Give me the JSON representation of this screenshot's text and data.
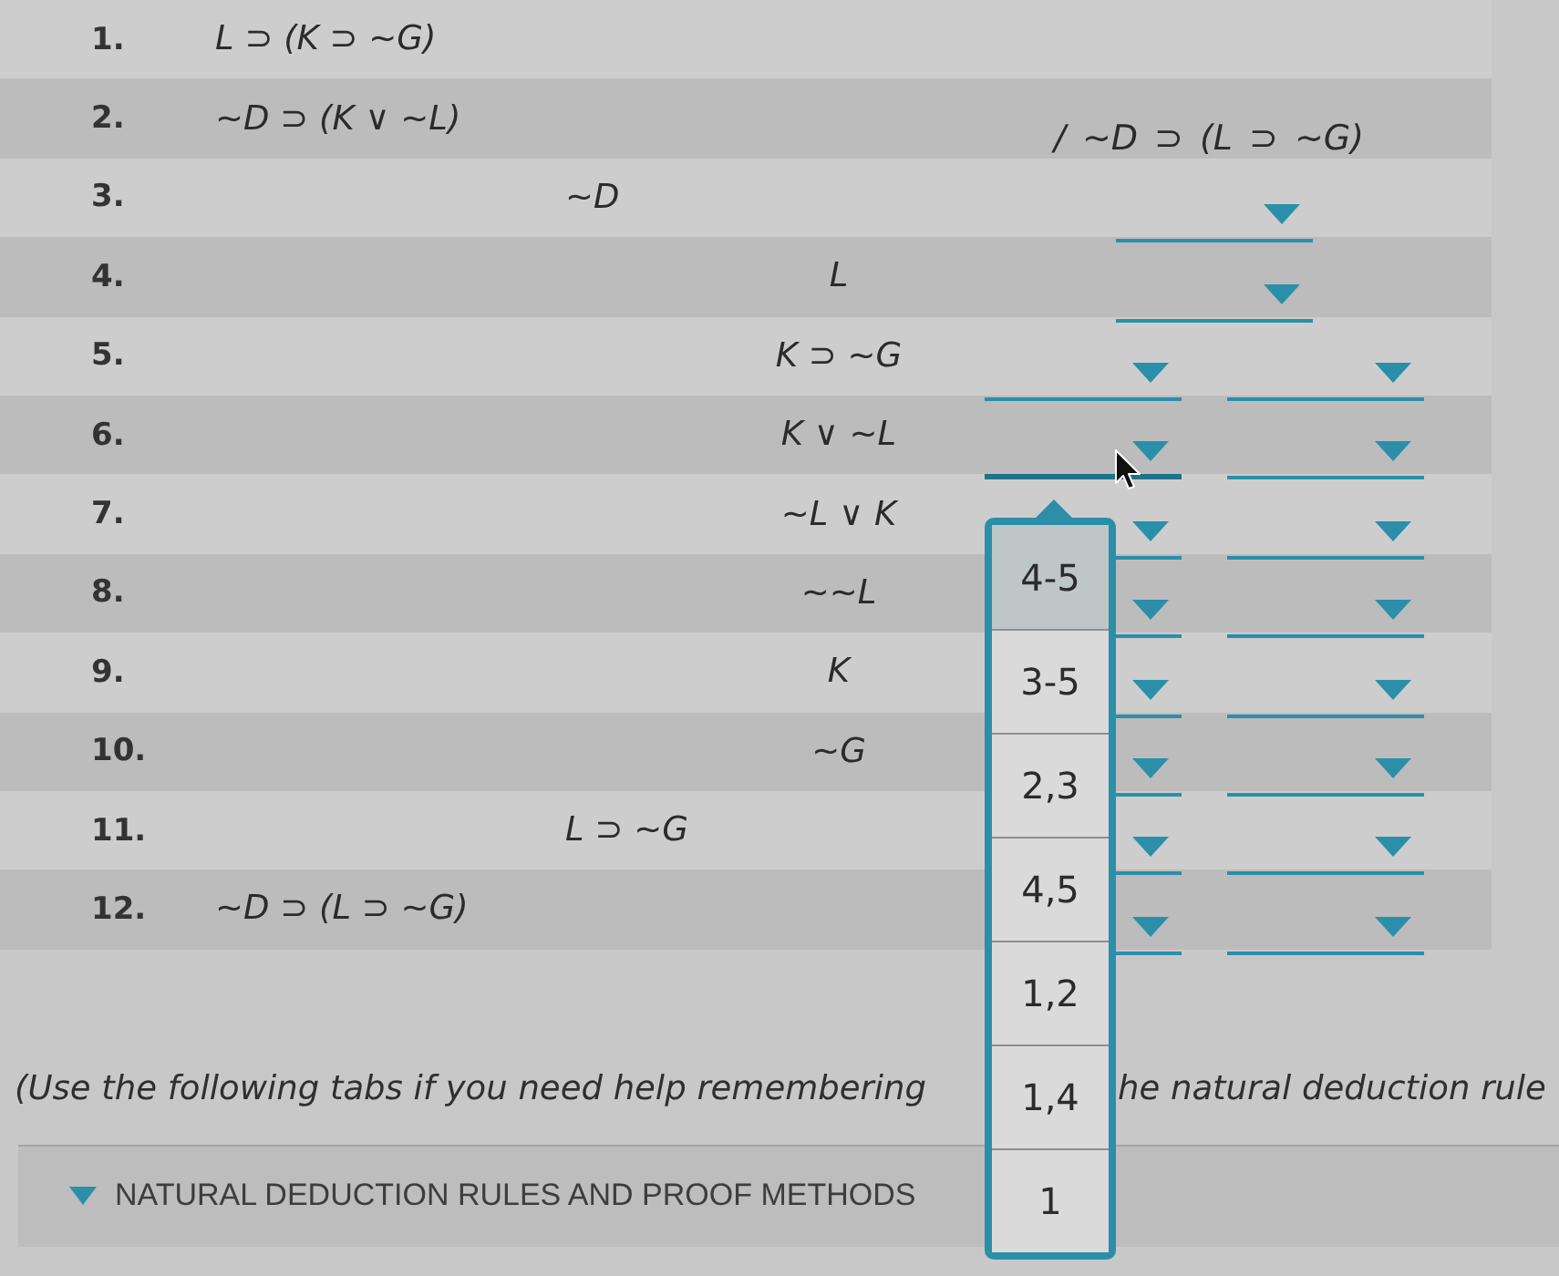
{
  "proof": {
    "items": [
      {
        "kind": "line",
        "number": "1.",
        "formula": "L ⊃ (K ⊃ ~G)"
      },
      {
        "kind": "line",
        "number": "2.",
        "formula": "~D ⊃ (K ∨ ~L)",
        "conclusion": "/ ~D ⊃ (L ⊃ ~G)"
      },
      {
        "kind": "subproof",
        "children": [
          {
            "kind": "line",
            "number": "3.",
            "formula": "~D",
            "justification": [
              {
                "expanded": false
              }
            ]
          },
          {
            "kind": "subproof",
            "children": [
              {
                "kind": "line",
                "number": "4.",
                "formula": "L",
                "justification": [
                  {
                    "expanded": false
                  }
                ]
              },
              {
                "kind": "line",
                "number": "5.",
                "formula": "K ⊃ ~G",
                "justification": [
                  {
                    "expanded": false
                  },
                  {
                    "expanded": false
                  }
                ]
              },
              {
                "kind": "line",
                "number": "6.",
                "formula": "K ∨ ~L",
                "justification": [
                  {
                    "expanded": true,
                    "options": [
                      {
                        "label": "4-5",
                        "selected": true
                      },
                      {
                        "label": "3-5",
                        "selected": false
                      },
                      {
                        "label": "2,3",
                        "selected": false
                      },
                      {
                        "label": "4,5",
                        "selected": false
                      },
                      {
                        "label": "1,2",
                        "selected": false
                      },
                      {
                        "label": "1,4",
                        "selected": false
                      },
                      {
                        "label": "1",
                        "selected": false
                      }
                    ]
                  },
                  {
                    "expanded": false
                  }
                ]
              },
              {
                "kind": "line",
                "number": "7.",
                "formula": "~L ∨ K",
                "justification": [
                  {
                    "expanded": false
                  },
                  {
                    "expanded": false
                  }
                ]
              },
              {
                "kind": "line",
                "number": "8.",
                "formula": "~~L",
                "justification": [
                  {
                    "expanded": false
                  },
                  {
                    "expanded": false
                  }
                ]
              },
              {
                "kind": "line",
                "number": "9.",
                "formula": "K",
                "justification": [
                  {
                    "expanded": false
                  },
                  {
                    "expanded": false
                  }
                ]
              },
              {
                "kind": "line",
                "number": "10.",
                "formula": "~G",
                "justification": [
                  {
                    "expanded": false
                  },
                  {
                    "expanded": false
                  }
                ]
              }
            ]
          },
          {
            "kind": "line",
            "number": "11.",
            "formula": "L ⊃ ~G",
            "justification": [
              {
                "expanded": false
              },
              {
                "expanded": false
              }
            ]
          }
        ]
      },
      {
        "kind": "line",
        "number": "12.",
        "formula": "~D ⊃ (L ⊃ ~G)",
        "justification": [
          {
            "expanded": false
          },
          {
            "expanded": false
          }
        ]
      }
    ]
  },
  "help_text": {
    "before": "(Use the following tabs if you need help remembering",
    "after": "he natural deduction rule"
  },
  "rules_panel": {
    "title": "NATURAL DEDUCTION RULES AND PROOF METHODS",
    "expanded": true
  }
}
